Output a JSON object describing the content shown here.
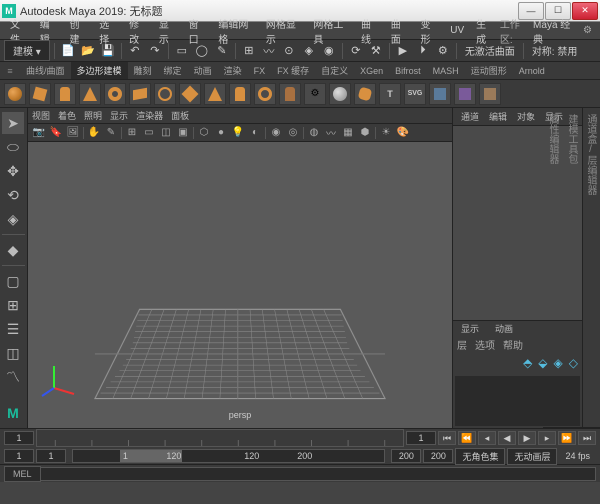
{
  "title": "Autodesk Maya 2019: 无标题",
  "app_icon": "M",
  "menubar": {
    "items": [
      "文件",
      "编辑",
      "创建",
      "选择",
      "修改",
      "显示",
      "窗口",
      "编辑网格",
      "网格显示",
      "网格工具",
      "曲线",
      "曲面",
      "变形",
      "UV",
      "生成"
    ],
    "workspace_label": "工作区:",
    "workspace": "Maya 经典"
  },
  "toolbar1": {
    "mode": "建模",
    "no_active": "无激活曲面",
    "sym_label": "对称: 禁用"
  },
  "shelf_tabs": [
    "曲线/曲面",
    "多边形建模",
    "雕刻",
    "绑定",
    "动画",
    "渲染",
    "FX",
    "FX 缓存",
    "自定义",
    "XGen",
    "Bifrost",
    "MASH",
    "运动图形",
    "Arnold"
  ],
  "shelf_active": 1,
  "viewport": {
    "menus": [
      "视图",
      "着色",
      "照明",
      "显示",
      "渲染器",
      "面板"
    ],
    "camera": "persp"
  },
  "right_panel": {
    "tabs": [
      "通道",
      "编辑",
      "对象",
      "显示"
    ],
    "tabs2": [
      "显示",
      "动画"
    ],
    "row": [
      "层",
      "选项",
      "帮助"
    ]
  },
  "side_tabs": [
    "通道盒/层编辑器",
    "建模工具包",
    "属性编辑器"
  ],
  "timeline": {
    "start": "1",
    "end": "120",
    "range_start": "1",
    "range_end": "120",
    "range2_start": "120",
    "range2_end": "200",
    "current": "1"
  },
  "anim": {
    "no_role": "无角色集",
    "no_layer": "无动画层",
    "fps": "24 fps"
  },
  "cmd": {
    "label": "MEL"
  }
}
